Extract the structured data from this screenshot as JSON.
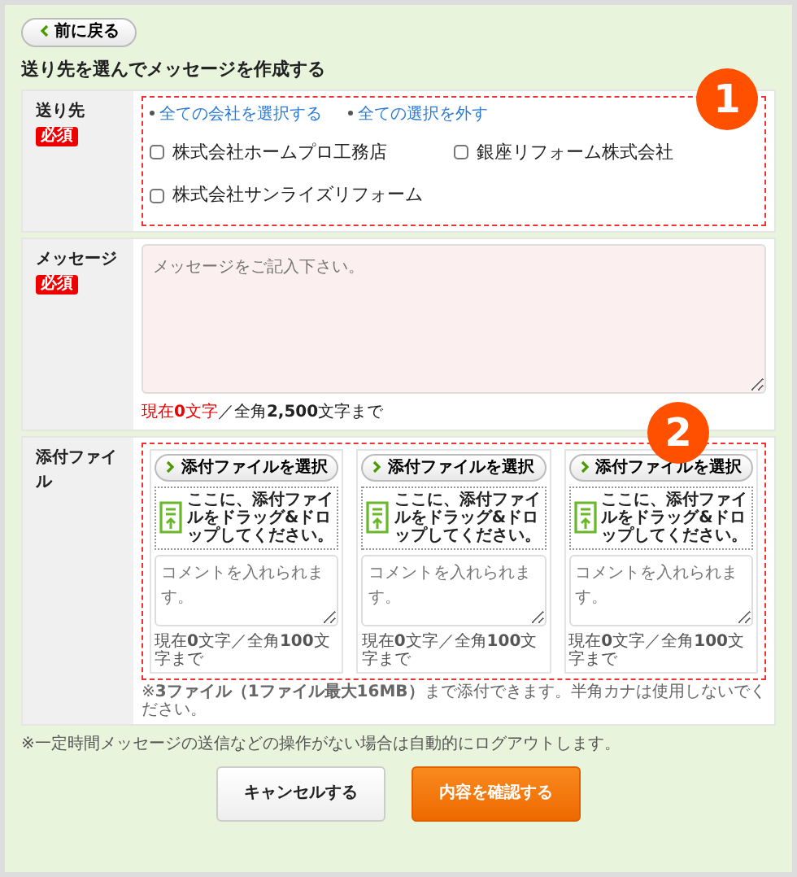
{
  "back_button": "前に戻る",
  "heading": "送り先を選んでメッセージを作成する",
  "recipients": {
    "label": "送り先",
    "badge": "必須",
    "callout": "1",
    "links": [
      "全ての会社を選択する",
      "全ての選択を外す"
    ],
    "companies": [
      {
        "name": "株式会社ホームプロ工務店",
        "checked": false
      },
      {
        "name": "銀座リフォーム株式会社",
        "checked": false
      },
      {
        "name": "株式会社サンライズリフォーム",
        "checked": false
      }
    ]
  },
  "message": {
    "label": "メッセージ",
    "badge": "必須",
    "placeholder": "メッセージをご記入下さい。",
    "counter_current": "現在**0**文字",
    "counter_limit": "／全角**2,500**文字まで"
  },
  "attachments": {
    "label": "添付ファイル",
    "callout": "2",
    "slots": [
      {
        "button": "添付ファイルを選択",
        "drop_text": "ここに、添付ファイルをドラッグ&ドロップしてください。",
        "placeholder": "コメントを入れられます。",
        "counter": "現在**0**文字／全角**100**文字まで"
      },
      {
        "button": "添付ファイルを選択",
        "drop_text": "ここに、添付ファイルをドラッグ&ドロップしてください。",
        "placeholder": "コメントを入れられます。",
        "counter": "現在**0**文字／全角**100**文字まで"
      },
      {
        "button": "添付ファイルを選択",
        "drop_text": "ここに、添付ファイルをドラッグ&ドロップしてください。",
        "placeholder": "コメントを入れられます。",
        "counter": "現在**0**文字／全角**100**文字まで"
      }
    ],
    "note": "※**3ファイル（1ファイル最大16MB）**まで添付できます。半角カナは使用しないでください。"
  },
  "footer_note": "※一定時間メッセージの送信などの操作がない場合は自動的にログアウトします。",
  "buttons": [
    {
      "label": "キャンセルする",
      "kind": "cancel"
    },
    {
      "label": "内容を確認する",
      "kind": "confirm"
    }
  ]
}
